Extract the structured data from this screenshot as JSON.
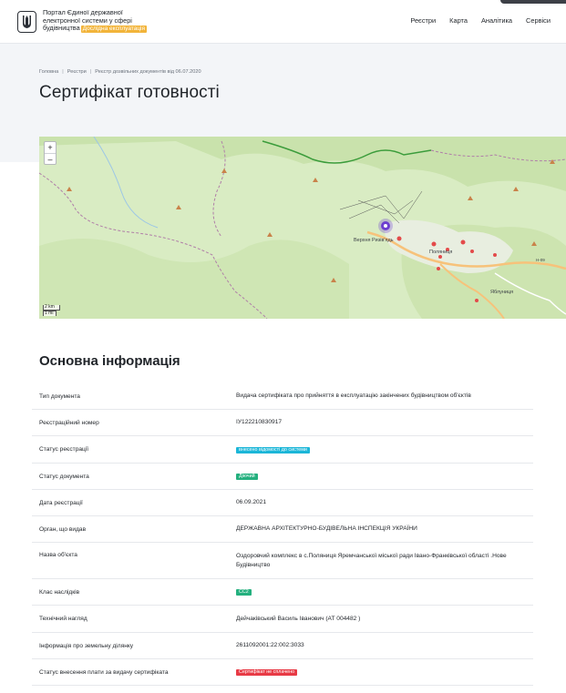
{
  "header": {
    "brand_lines": [
      "Портал Єдиної державної",
      "електронної системи у сфері",
      "будівництва"
    ],
    "beta_label": "Дослідна експлуатація",
    "nav": [
      "Реєстри",
      "Карта",
      "Аналітика",
      "Сервіси"
    ]
  },
  "breadcrumb": [
    "Головна",
    "Реєстри",
    "Реєстр дозвільних документів від 06.07.2020"
  ],
  "page_title": "Сертифікат готовності",
  "map": {
    "zoom_in": "+",
    "zoom_out": "–",
    "scale": [
      "2 km",
      "1 mi"
    ],
    "place_labels": [
      "Верхня Ризів'ядь",
      "Поляниця",
      "Яблуниця",
      "Н-09"
    ],
    "colors": {
      "land": "#d9ecc3",
      "forest": "#c3dda3",
      "road": "#f7c27a",
      "border": "#3b9c3b",
      "marker": "#6d3fd0",
      "poi": "#e34a4a"
    }
  },
  "section_title": "Основна інформація",
  "info": [
    {
      "label": "Тип документа",
      "value": "Видача сертифіката про прийняття в експлуатацію закінчених будівництвом об'єктів"
    },
    {
      "label": "Реєстраційний номер",
      "value": "ІУ122210830917"
    },
    {
      "label": "Статус реєстрації",
      "badge": "внесено відомості до системи",
      "badge_color": "cyan"
    },
    {
      "label": "Статус документа",
      "badge": "Діючий",
      "badge_color": "green"
    },
    {
      "label": "Дата реєстрації",
      "value": "06.09.2021"
    },
    {
      "label": "Орган, що видав",
      "value": "ДЕРЖАВНА АРХІТЕКТУРНО-БУДІВЕЛЬНА ІНСПЕКЦІЯ УКРАЇНИ"
    },
    {
      "label": "Назва об'єкта",
      "value": "Оздоровчий комплекс в с.Поляниця Яремчанської міської ради Івано-Франківської області .Нове Будівництво"
    },
    {
      "label": "Клас наслідків",
      "badge": "СС2",
      "badge_color": "green"
    },
    {
      "label": "Технічний нагляд",
      "value": "Дейчаківський Василь Іванович (АТ 004482 )"
    },
    {
      "label": "Інформація про земельну ділянку",
      "value": "2611092001:22:002:3033"
    },
    {
      "label": "Статус внесення плати за видачу сертифіката",
      "badge": "Сертифікат не сплачено",
      "badge_color": "red"
    }
  ]
}
